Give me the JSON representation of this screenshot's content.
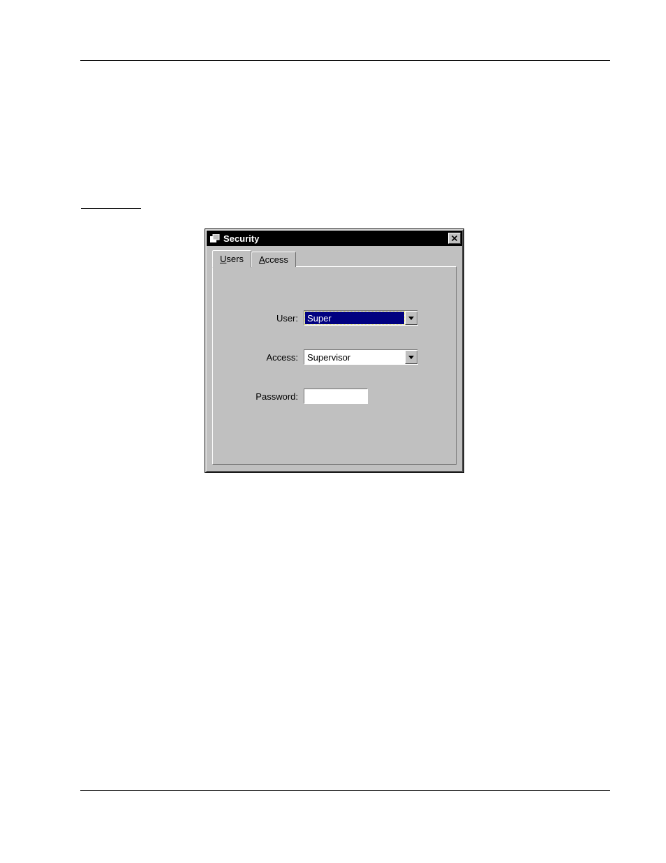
{
  "dialog": {
    "title": "Security",
    "tabs": {
      "users": {
        "accelerator": "U",
        "rest": "sers"
      },
      "access": {
        "accelerator": "A",
        "rest": "ccess"
      }
    },
    "fields": {
      "user": {
        "label": "User:",
        "value": "Super"
      },
      "access": {
        "label": "Access:",
        "value": "Supervisor"
      },
      "password": {
        "label": "Password:",
        "value": ""
      }
    }
  }
}
